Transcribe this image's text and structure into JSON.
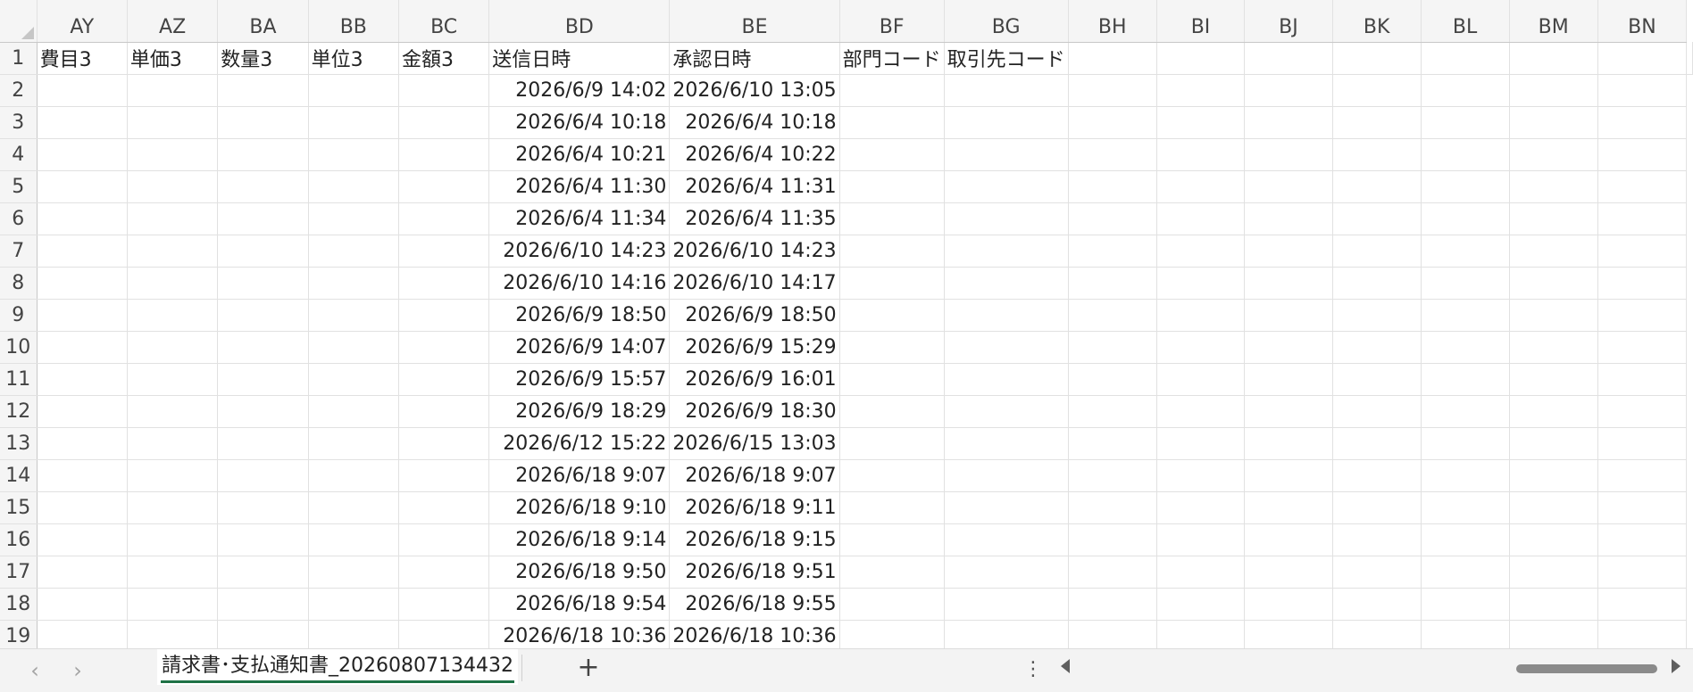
{
  "columns": [
    "AY",
    "AZ",
    "BA",
    "BB",
    "BC",
    "BD",
    "BE",
    "BF",
    "BG",
    "BH",
    "BI",
    "BJ",
    "BK",
    "BL",
    "BM",
    "BN"
  ],
  "header_row": {
    "num": "1",
    "cells": [
      "費目3",
      "単価3",
      "数量3",
      "単位3",
      "金額3",
      "送信日時",
      "承認日時",
      "部門コード",
      "取引先コード"
    ]
  },
  "rows": [
    {
      "num": "2",
      "sent": "2026/6/9 14:02",
      "approved": "2026/6/10 13:05"
    },
    {
      "num": "3",
      "sent": "2026/6/4 10:18",
      "approved": "2026/6/4 10:18"
    },
    {
      "num": "4",
      "sent": "2026/6/4 10:21",
      "approved": "2026/6/4 10:22"
    },
    {
      "num": "5",
      "sent": "2026/6/4 11:30",
      "approved": "2026/6/4 11:31"
    },
    {
      "num": "6",
      "sent": "2026/6/4 11:34",
      "approved": "2026/6/4 11:35"
    },
    {
      "num": "7",
      "sent": "2026/6/10 14:23",
      "approved": "2026/6/10 14:23"
    },
    {
      "num": "8",
      "sent": "2026/6/10 14:16",
      "approved": "2026/6/10 14:17"
    },
    {
      "num": "9",
      "sent": "2026/6/9 18:50",
      "approved": "2026/6/9 18:50"
    },
    {
      "num": "10",
      "sent": "2026/6/9 14:07",
      "approved": "2026/6/9 15:29"
    },
    {
      "num": "11",
      "sent": "2026/6/9 15:57",
      "approved": "2026/6/9 16:01"
    },
    {
      "num": "12",
      "sent": "2026/6/9 18:29",
      "approved": "2026/6/9 18:30"
    },
    {
      "num": "13",
      "sent": "2026/6/12 15:22",
      "approved": "2026/6/15 13:03"
    },
    {
      "num": "14",
      "sent": "2026/6/18 9:07",
      "approved": "2026/6/18 9:07"
    },
    {
      "num": "15",
      "sent": "2026/6/18 9:10",
      "approved": "2026/6/18 9:11"
    },
    {
      "num": "16",
      "sent": "2026/6/18 9:14",
      "approved": "2026/6/18 9:15"
    },
    {
      "num": "17",
      "sent": "2026/6/18 9:50",
      "approved": "2026/6/18 9:51"
    },
    {
      "num": "18",
      "sent": "2026/6/18 9:54",
      "approved": "2026/6/18 9:55"
    },
    {
      "num": "19",
      "sent": "2026/6/18 10:36",
      "approved": "2026/6/18 10:36"
    }
  ],
  "tabs": {
    "prev_icon": "chevron-left-icon",
    "next_icon": "chevron-right-icon",
    "active_sheet": "請求書･支払通知書_20260807134432",
    "add_icon": "plus-icon",
    "more_icon": "vertical-dots-icon"
  }
}
